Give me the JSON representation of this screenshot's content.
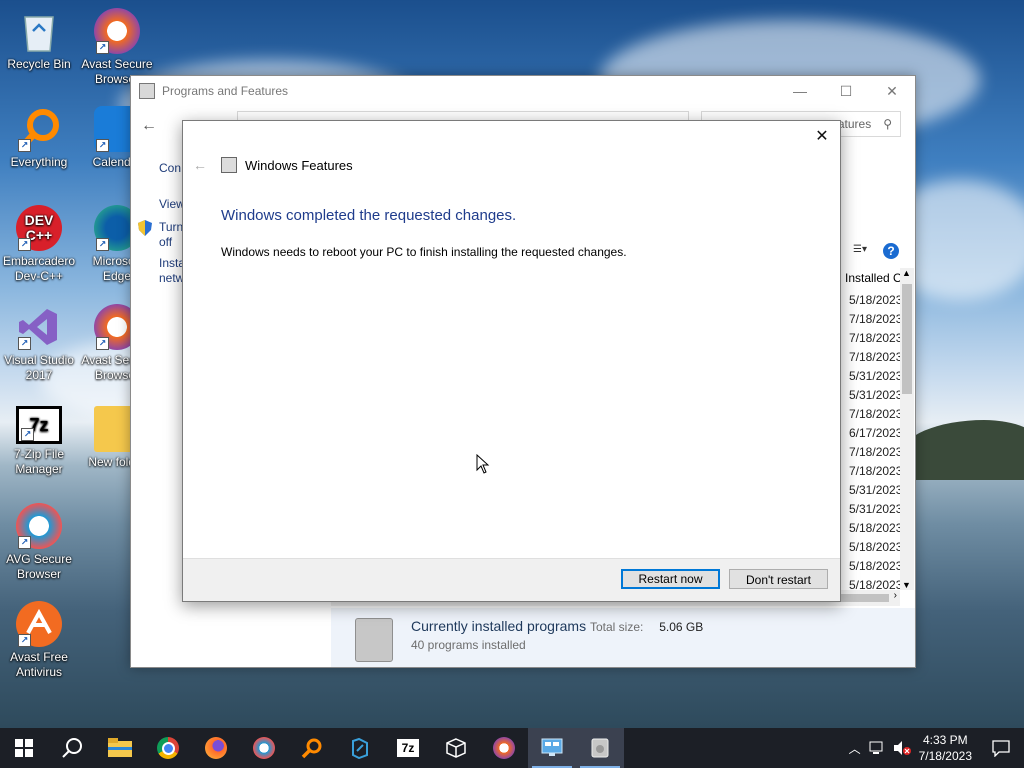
{
  "desktop": {
    "icons": [
      {
        "label": "Recycle Bin"
      },
      {
        "label": "Avast Secure Browser"
      },
      {
        "label": "Everything"
      },
      {
        "label": "Calendar"
      },
      {
        "label": "Embarcadero Dev-C++"
      },
      {
        "label": "Microsoft Edge"
      },
      {
        "label": "Visual Studio 2017"
      },
      {
        "label": "Avast Secure Browser"
      },
      {
        "label": "7-Zip File Manager"
      },
      {
        "label": "New folder"
      },
      {
        "label": "AVG Secure Browser"
      },
      {
        "label": "Avast Free Antivirus"
      }
    ]
  },
  "programs_window": {
    "title": "Programs and Features",
    "search_placeholder": "atures",
    "side_links": [
      "Con",
      "View",
      "Turn",
      "off",
      "Insta",
      "netw"
    ],
    "column_header": "Installed O",
    "installed_dates": [
      "5/18/2023",
      "7/18/2023",
      "7/18/2023",
      "7/18/2023",
      "5/31/2023",
      "5/31/2023",
      "7/18/2023",
      "6/17/2023",
      "7/18/2023",
      "7/18/2023",
      "5/31/2023",
      "5/31/2023",
      "5/18/2023",
      "5/18/2023",
      "5/18/2023",
      "5/18/2023"
    ],
    "details": {
      "name": "Currently installed programs",
      "size_label": "Total size:",
      "size_value": "5.06 GB",
      "count": "40 programs installed"
    }
  },
  "features_dialog": {
    "title": "Windows Features",
    "heading": "Windows completed the requested changes.",
    "message": "Windows needs to reboot your PC to finish installing the requested changes.",
    "restart_label": "Restart now",
    "dont_restart_label": "Don't restart",
    "close_glyph": "✕"
  },
  "taskbar": {
    "time": "4:33 PM",
    "date": "7/18/2023",
    "items": [
      "start-icon",
      "search-icon",
      "file-explorer-icon",
      "chrome-icon",
      "firefox-icon",
      "avg-browser-icon",
      "everything-icon",
      "visual-studio-icon",
      "7zip-icon",
      "package-icon",
      "avast-browser-icon",
      "control-panel-icon",
      "programs-features-icon"
    ]
  }
}
